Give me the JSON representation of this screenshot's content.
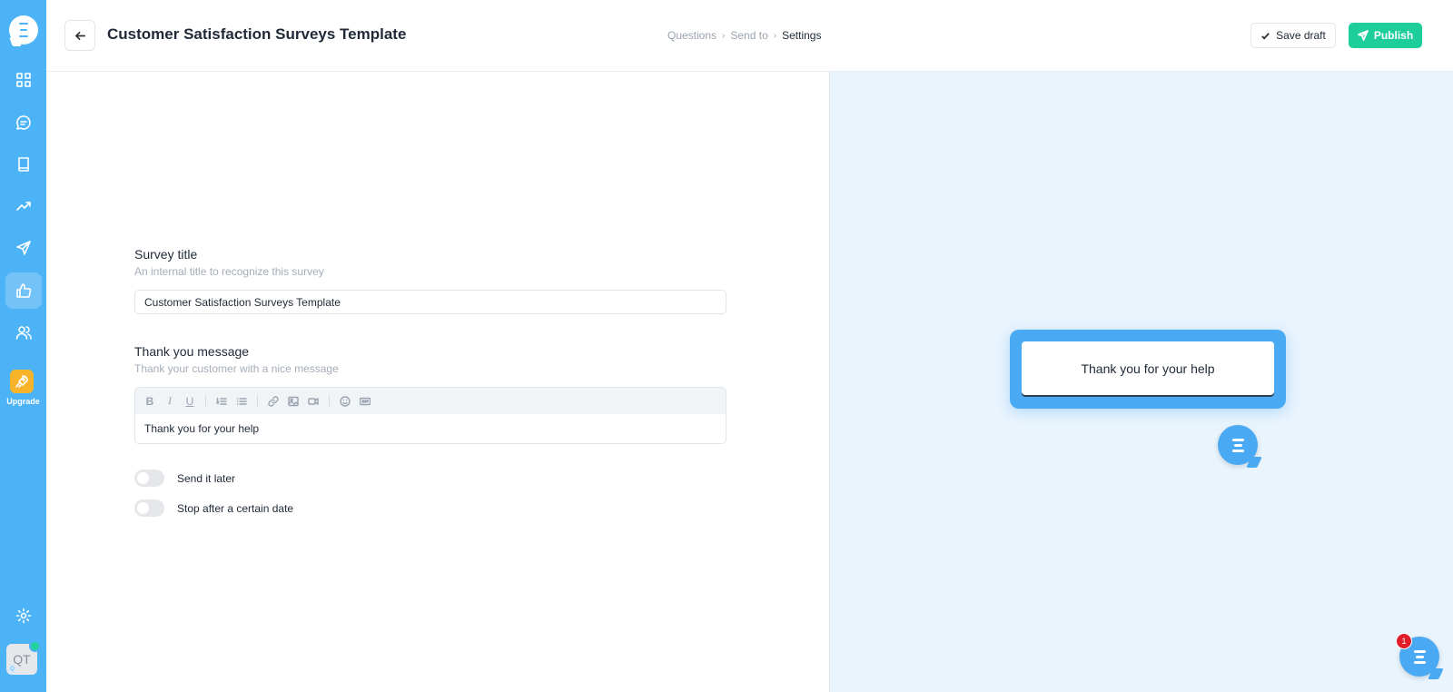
{
  "header": {
    "title": "Customer Satisfaction Surveys Template",
    "breadcrumbs": [
      "Questions",
      "Send to",
      "Settings"
    ],
    "save_label": "Save draft",
    "publish_label": "Publish"
  },
  "sidebar": {
    "items": [
      {
        "icon": "dashboard-grid-icon"
      },
      {
        "icon": "chat-icon"
      },
      {
        "icon": "book-icon"
      },
      {
        "icon": "trending-icon"
      },
      {
        "icon": "send-icon"
      },
      {
        "icon": "thumbs-up-icon",
        "active": true
      },
      {
        "icon": "users-icon"
      }
    ],
    "upgrade_label": "Upgrade",
    "avatar_initials": "QT",
    "avatar_small": "Q"
  },
  "form": {
    "survey_title": {
      "label": "Survey title",
      "hint": "An internal title to recognize this survey",
      "value": "Customer Satisfaction Surveys Template"
    },
    "thank_you": {
      "label": "Thank you message",
      "hint": "Thank your customer with a nice message",
      "value": "Thank you for your help"
    },
    "toggles": [
      {
        "label": "Send it later",
        "on": false
      },
      {
        "label": "Stop after a certain date",
        "on": false
      }
    ]
  },
  "preview": {
    "message": "Thank you for your help"
  },
  "chat_widget": {
    "badge_count": "1"
  },
  "colors": {
    "sidebar": "#4db3f7",
    "publish": "#1dcd9a",
    "preview_bg": "#e9f4fd",
    "upgrade": "#f7b42b"
  }
}
